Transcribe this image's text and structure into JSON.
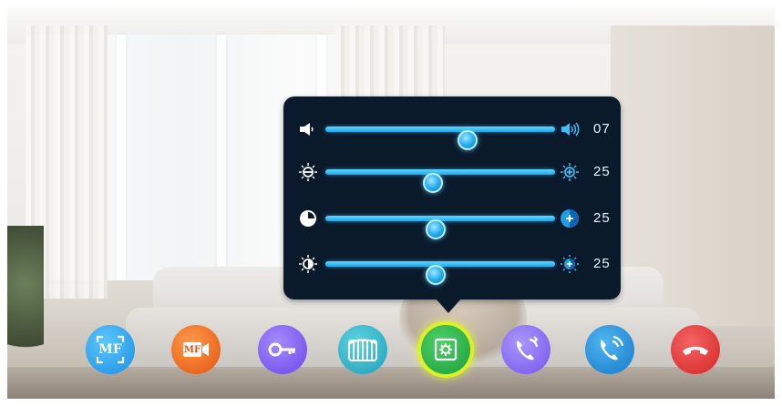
{
  "settings_panel": {
    "rows": [
      {
        "id": "volume",
        "left_icon": "speaker-low-icon",
        "right_icon": "speaker-high-icon",
        "value": "07",
        "level": 0.62
      },
      {
        "id": "brightness",
        "left_icon": "brightness-low-icon",
        "right_icon": "brightness-high-icon",
        "value": "25",
        "level": 0.47
      },
      {
        "id": "contrast",
        "left_icon": "contrast-low-icon",
        "right_icon": "contrast-high-icon",
        "value": "25",
        "level": 0.48
      },
      {
        "id": "color",
        "left_icon": "color-low-icon",
        "right_icon": "color-high-icon",
        "value": "25",
        "level": 0.48
      }
    ]
  },
  "toolbar": {
    "buttons": [
      {
        "id": "monitor",
        "icon": "mf-frame-icon",
        "label": "MF",
        "color": "#2ea8ef"
      },
      {
        "id": "record",
        "icon": "mf-video-icon",
        "label": "MF",
        "color": "#f06a1e"
      },
      {
        "id": "unlock",
        "icon": "key-icon",
        "color": "#7c5cf0"
      },
      {
        "id": "gate",
        "icon": "gate-icon",
        "color": "#2bb5c9"
      },
      {
        "id": "settings",
        "icon": "settings-icon",
        "color": "#27b34a",
        "active": true
      },
      {
        "id": "transfer",
        "icon": "phone-transfer-icon",
        "color": "#8a6df2"
      },
      {
        "id": "answer",
        "icon": "phone-answer-icon",
        "color": "#1f8fd8"
      },
      {
        "id": "hangup",
        "icon": "phone-hangup-icon",
        "color": "#e23b3b"
      }
    ]
  }
}
